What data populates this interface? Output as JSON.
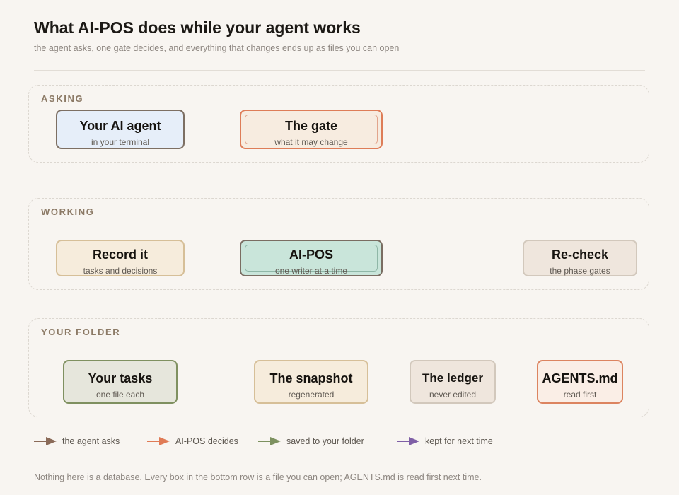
{
  "header": {
    "title": "What AI-POS does while your agent works",
    "subtitle": "the agent asks, one gate decides, and everything that changes ends up as files you can open"
  },
  "lanes": {
    "asking": {
      "label": "ASKING"
    },
    "working": {
      "label": "WORKING"
    },
    "folder": {
      "label": "YOUR FOLDER"
    }
  },
  "nodes": {
    "agent": {
      "title": "Your AI agent",
      "sub": "in your terminal"
    },
    "gate": {
      "title": "The gate",
      "sub": "what it may change"
    },
    "record": {
      "title": "Record it",
      "sub": "tasks and decisions"
    },
    "aipos": {
      "title": "AI-POS",
      "sub": "one writer at a time"
    },
    "recheck": {
      "title": "Re-check",
      "sub": "the phase gates"
    },
    "tasks": {
      "title": "Your tasks",
      "sub": "one file each"
    },
    "snapshot": {
      "title": "The snapshot",
      "sub": "regenerated"
    },
    "ledger": {
      "title": "The ledger",
      "sub": "never edited"
    },
    "agentsmd": {
      "title": "AGENTS.md",
      "sub": "read first"
    }
  },
  "legend": [
    {
      "label": "the agent asks",
      "color": "#8a6a58"
    },
    {
      "label": "AI-POS decides",
      "color": "#e07b56"
    },
    {
      "label": "saved to your folder",
      "color": "#7d9160"
    },
    {
      "label": "kept for next time",
      "color": "#7f5fa6"
    }
  ],
  "footer": "Nothing here is a database. Every box in the bottom row is a file you can open; AGENTS.md is read first next time."
}
